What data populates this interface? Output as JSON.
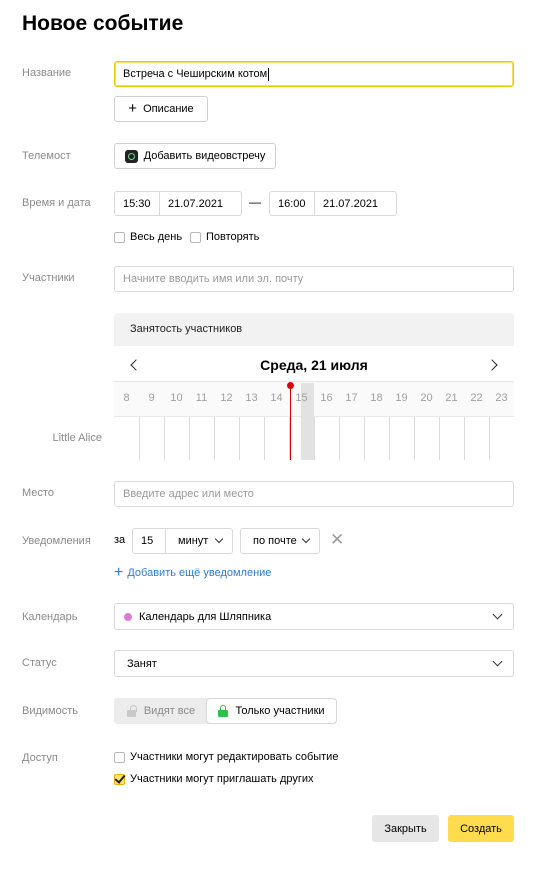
{
  "title": "Новое событие",
  "name": {
    "label": "Название",
    "value": "Встреча с Чеширским котом",
    "description_button": "Описание"
  },
  "telemost": {
    "label": "Телемост",
    "button": "Добавить видеовстречу"
  },
  "datetime": {
    "label": "Время и дата",
    "start_time": "15:30",
    "start_date": "21.07.2021",
    "dash": "—",
    "end_time": "16:00",
    "end_date": "21.07.2021",
    "all_day": "Весь день",
    "repeat": "Повторять"
  },
  "participants": {
    "label": "Участники",
    "placeholder": "Начните вводить имя или эл. почту",
    "busy_title": "Занятость участников",
    "day": "Среда, 21 июля",
    "hours": [
      "8",
      "9",
      "10",
      "11",
      "12",
      "13",
      "14",
      "15",
      "16",
      "17",
      "18",
      "19",
      "20",
      "21",
      "22",
      "23"
    ],
    "people": [
      "Little Alice"
    ]
  },
  "place": {
    "label": "Место",
    "placeholder": "Введите адрес или место"
  },
  "notifications": {
    "label": "Уведомления",
    "prefix": "за",
    "amount": "15",
    "unit": "минут",
    "channel": "по почте",
    "add_link": "Добавить ещё уведомление"
  },
  "calendar": {
    "label": "Календарь",
    "value": "Календарь для Шляпника",
    "dot_color": "#e07bd0"
  },
  "status": {
    "label": "Статус",
    "value": "Занят"
  },
  "visibility": {
    "label": "Видимость",
    "option_all": "Видят все",
    "option_participants": "Только участники"
  },
  "access": {
    "label": "Доступ",
    "can_edit": {
      "text": "Участники могут редактировать событие",
      "checked": false
    },
    "can_invite": {
      "text": "Участники могут приглашать других",
      "checked": true
    }
  },
  "actions": {
    "close": "Закрыть",
    "create": "Создать"
  },
  "colors": {
    "accent": "#ffdb4d",
    "link": "#2f7cd3",
    "now_line": "#cc0000"
  }
}
